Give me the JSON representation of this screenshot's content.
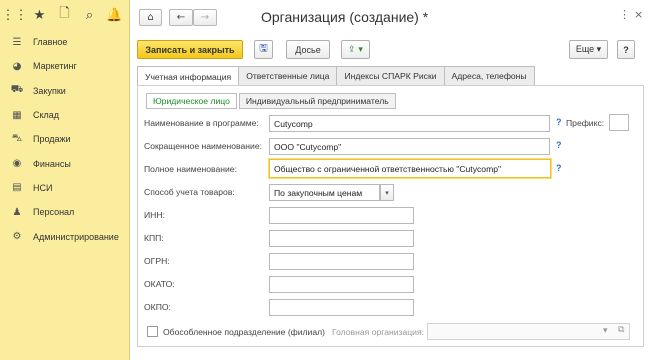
{
  "sidebar": {
    "top_icons": [
      {
        "icon": "apps-grid-icon",
        "glyph": "⋮⋮"
      },
      {
        "icon": "star-icon",
        "glyph": "★"
      },
      {
        "icon": "history-icon",
        "glyph": "🗋"
      },
      {
        "icon": "search-icon",
        "glyph": "⌕"
      },
      {
        "icon": "bell-icon",
        "glyph": "🔔"
      }
    ],
    "items": [
      {
        "label": "Главное",
        "icon": "menu-lines-icon",
        "glyph": "☰"
      },
      {
        "label": "Маркетинг",
        "icon": "pie-chart-icon",
        "glyph": "◕"
      },
      {
        "label": "Закупки",
        "icon": "truck-icon",
        "glyph": "⛟"
      },
      {
        "label": "Склад",
        "icon": "warehouse-icon",
        "glyph": "▦"
      },
      {
        "label": "Продажи",
        "icon": "cart-icon",
        "glyph": "⛍"
      },
      {
        "label": "Финансы",
        "icon": "coin-icon",
        "glyph": "◉"
      },
      {
        "label": "НСИ",
        "icon": "book-icon",
        "glyph": "▤"
      },
      {
        "label": "Персонал",
        "icon": "person-icon",
        "glyph": "♟"
      },
      {
        "label": "Администрирование",
        "icon": "gear-icon",
        "glyph": "⚙"
      }
    ]
  },
  "window": {
    "title": "Организация (создание) *",
    "home_glyph": "⌂",
    "back_glyph": "←",
    "forward_glyph": "→",
    "menu_glyph": "⋮",
    "close_glyph": "×"
  },
  "toolbar": {
    "save_close": "Записать и закрыть",
    "save_glyph": "🖫",
    "dossier": "Досье",
    "export_glyph": "⇪ ▾",
    "more": "Еще ▾",
    "help": "?"
  },
  "tabs": [
    "Учетная информация",
    "Ответственные лица",
    "Индексы СПАРК Риски",
    "Адреса, телефоны"
  ],
  "subtabs": [
    "Юридическое лицо",
    "Индивидуальный предприниматель"
  ],
  "form": {
    "name_label": "Наименование в программе:",
    "name_value": "Cutycomp",
    "prefix_label": "Префикс:",
    "prefix_value": "",
    "short_label": "Сокращенное наименование:",
    "short_value": "ООО \"Cutycomp\"",
    "full_label": "Полное наименование:",
    "full_value": "Общество с ограниченной ответственностью \"Cutycomp\"",
    "accounting_label": "Способ учета товаров:",
    "accounting_value": "По закупочным ценам",
    "inn_label": "ИНН:",
    "kpp_label": "КПП:",
    "ogrn_label": "ОГРН:",
    "okato_label": "ОКАТО:",
    "okpo_label": "ОКПО:",
    "branch_label": "Обособленное подразделение (филиал)",
    "head_org_label": "Головная организация:",
    "head_org_value": "",
    "q": "?"
  }
}
